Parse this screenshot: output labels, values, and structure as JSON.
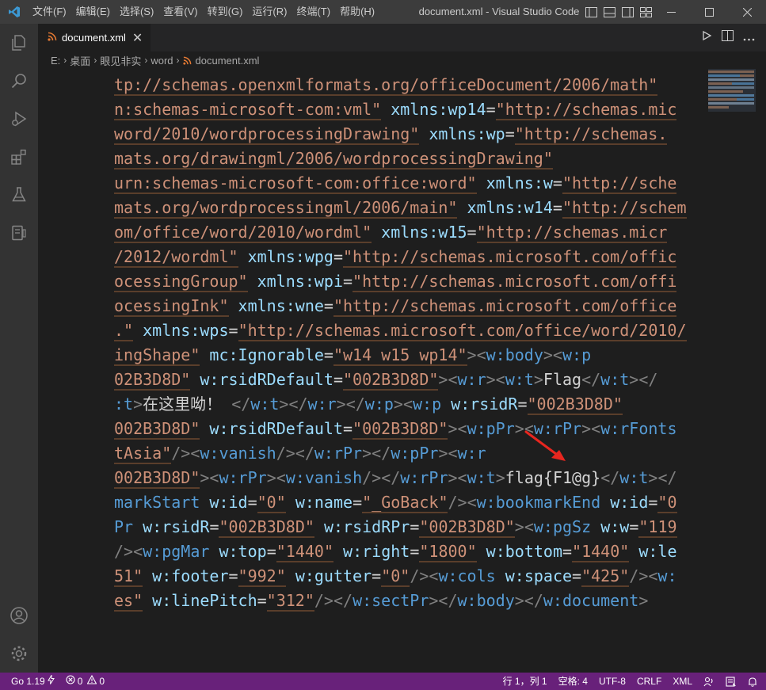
{
  "titlebar": {
    "menu": [
      "文件(F)",
      "编辑(E)",
      "选择(S)",
      "查看(V)",
      "转到(G)",
      "运行(R)",
      "终端(T)",
      "帮助(H)"
    ],
    "window_title": "document.xml - Visual Studio Code"
  },
  "tabs": [
    {
      "label": "document.xml",
      "icon": "rss-icon",
      "active": true
    }
  ],
  "breadcrumb": [
    "E:",
    "桌面",
    "眼见非实",
    "word",
    "document.xml"
  ],
  "code_lines": [
    [
      [
        "t-str",
        "tp://schemas.openxmlformats.org/officeDocument/2006/math\""
      ]
    ],
    [
      [
        "t-str",
        "n:schemas-microsoft-com:vml\""
      ],
      [
        "t-text",
        " "
      ],
      [
        "t-attr",
        "xmlns:wp14"
      ],
      [
        "t-text",
        "="
      ],
      [
        "t-str",
        "\"http://schemas.mic"
      ]
    ],
    [
      [
        "t-str",
        "word/2010/wordprocessingDrawing\""
      ],
      [
        "t-text",
        " "
      ],
      [
        "t-attr",
        "xmlns:wp"
      ],
      [
        "t-text",
        "="
      ],
      [
        "t-str",
        "\"http://schemas."
      ]
    ],
    [
      [
        "t-str",
        "mats.org/drawingml/2006/wordprocessingDrawing\""
      ]
    ],
    [
      [
        "t-str",
        "urn:schemas-microsoft-com:office:word\""
      ],
      [
        "t-text",
        " "
      ],
      [
        "t-attr",
        "xmlns:w"
      ],
      [
        "t-text",
        "="
      ],
      [
        "t-str",
        "\"http://sche"
      ]
    ],
    [
      [
        "t-str",
        "mats.org/wordprocessingml/2006/main\""
      ],
      [
        "t-text",
        " "
      ],
      [
        "t-attr",
        "xmlns:w14"
      ],
      [
        "t-text",
        "="
      ],
      [
        "t-str",
        "\"http://schem"
      ]
    ],
    [
      [
        "t-str",
        "om/office/word/2010/wordml\""
      ],
      [
        "t-text",
        " "
      ],
      [
        "t-attr",
        "xmlns:w15"
      ],
      [
        "t-text",
        "="
      ],
      [
        "t-str",
        "\"http://schemas.micr"
      ]
    ],
    [
      [
        "t-str",
        "/2012/wordml\""
      ],
      [
        "t-text",
        " "
      ],
      [
        "t-attr",
        "xmlns:wpg"
      ],
      [
        "t-text",
        "="
      ],
      [
        "t-str",
        "\"http://schemas.microsoft.com/offic"
      ]
    ],
    [
      [
        "t-str",
        "ocessingGroup\""
      ],
      [
        "t-text",
        " "
      ],
      [
        "t-attr",
        "xmlns:wpi"
      ],
      [
        "t-text",
        "="
      ],
      [
        "t-str",
        "\"http://schemas.microsoft.com/offi"
      ]
    ],
    [
      [
        "t-str",
        "ocessingInk\""
      ],
      [
        "t-text",
        " "
      ],
      [
        "t-attr",
        "xmlns:wne"
      ],
      [
        "t-text",
        "="
      ],
      [
        "t-str",
        "\"http://schemas.microsoft.com/office"
      ]
    ],
    [
      [
        "t-str",
        ".\""
      ],
      [
        "t-text",
        " "
      ],
      [
        "t-attr",
        "xmlns:wps"
      ],
      [
        "t-text",
        "="
      ],
      [
        "t-str",
        "\"http://schemas.microsoft.com/office/word/2010/"
      ]
    ],
    [
      [
        "t-str",
        "ingShape\""
      ],
      [
        "t-text",
        " "
      ],
      [
        "t-attr",
        "mc:Ignorable"
      ],
      [
        "t-text",
        "="
      ],
      [
        "t-str",
        "\"w14 w15 wp14\""
      ],
      [
        "t-punc",
        "><"
      ],
      [
        "t-tag",
        "w:body"
      ],
      [
        "t-punc",
        "><"
      ],
      [
        "t-tag",
        "w:p"
      ]
    ],
    [
      [
        "t-str",
        "02B3D8D\""
      ],
      [
        "t-text",
        " "
      ],
      [
        "t-attr",
        "w:rsidRDefault"
      ],
      [
        "t-text",
        "="
      ],
      [
        "t-str",
        "\"002B3D8D\""
      ],
      [
        "t-punc",
        "><"
      ],
      [
        "t-tag",
        "w:r"
      ],
      [
        "t-punc",
        "><"
      ],
      [
        "t-tag",
        "w:t"
      ],
      [
        "t-punc",
        ">"
      ],
      [
        "t-text",
        "Flag"
      ],
      [
        "t-punc",
        "</"
      ],
      [
        "t-tag",
        "w:t"
      ],
      [
        "t-punc",
        "></"
      ]
    ],
    [
      [
        "t-tag",
        ":t"
      ],
      [
        "t-punc",
        ">"
      ],
      [
        "t-text",
        "在这里呦！ "
      ],
      [
        "t-punc",
        "</"
      ],
      [
        "t-tag",
        "w:t"
      ],
      [
        "t-punc",
        "></"
      ],
      [
        "t-tag",
        "w:r"
      ],
      [
        "t-punc",
        "></"
      ],
      [
        "t-tag",
        "w:p"
      ],
      [
        "t-punc",
        "><"
      ],
      [
        "t-tag",
        "w:p"
      ],
      [
        "t-text",
        " "
      ],
      [
        "t-attr",
        "w:rsidR"
      ],
      [
        "t-text",
        "="
      ],
      [
        "t-str",
        "\"002B3D8D\""
      ]
    ],
    [
      [
        "t-str",
        "002B3D8D\""
      ],
      [
        "t-text",
        " "
      ],
      [
        "t-attr",
        "w:rsidRDefault"
      ],
      [
        "t-text",
        "="
      ],
      [
        "t-str",
        "\"002B3D8D\""
      ],
      [
        "t-punc",
        "><"
      ],
      [
        "t-tag",
        "w:pPr"
      ],
      [
        "t-punc",
        "><"
      ],
      [
        "t-tag",
        "w:rPr"
      ],
      [
        "t-punc",
        "><"
      ],
      [
        "t-tag",
        "w:rFonts"
      ]
    ],
    [
      [
        "t-str",
        "tAsia\""
      ],
      [
        "t-punc",
        "/><"
      ],
      [
        "t-tag",
        "w:vanish"
      ],
      [
        "t-punc",
        "/></"
      ],
      [
        "t-tag",
        "w:rPr"
      ],
      [
        "t-punc",
        "></"
      ],
      [
        "t-tag",
        "w:pPr"
      ],
      [
        "t-punc",
        "><"
      ],
      [
        "t-tag",
        "w:r"
      ]
    ],
    [
      [
        "t-str",
        "002B3D8D\""
      ],
      [
        "t-punc",
        "><"
      ],
      [
        "t-tag",
        "w:rPr"
      ],
      [
        "t-punc",
        "><"
      ],
      [
        "t-tag",
        "w:vanish"
      ],
      [
        "t-punc",
        "/></"
      ],
      [
        "t-tag",
        "w:rPr"
      ],
      [
        "t-punc",
        "><"
      ],
      [
        "t-tag",
        "w:t"
      ],
      [
        "t-punc",
        ">"
      ],
      [
        "t-text",
        "flag{F1@g}"
      ],
      [
        "t-punc",
        "</"
      ],
      [
        "t-tag",
        "w:t"
      ],
      [
        "t-punc",
        "></"
      ]
    ],
    [
      [
        "t-tag",
        "markStart"
      ],
      [
        "t-text",
        " "
      ],
      [
        "t-attr",
        "w:id"
      ],
      [
        "t-text",
        "="
      ],
      [
        "t-str",
        "\"0\""
      ],
      [
        "t-text",
        " "
      ],
      [
        "t-attr",
        "w:name"
      ],
      [
        "t-text",
        "="
      ],
      [
        "t-str",
        "\"_GoBack\""
      ],
      [
        "t-punc",
        "/><"
      ],
      [
        "t-tag",
        "w:bookmarkEnd"
      ],
      [
        "t-text",
        " "
      ],
      [
        "t-attr",
        "w:id"
      ],
      [
        "t-text",
        "="
      ],
      [
        "t-str",
        "\"0"
      ]
    ],
    [
      [
        "t-tag",
        "Pr"
      ],
      [
        "t-text",
        " "
      ],
      [
        "t-attr",
        "w:rsidR"
      ],
      [
        "t-text",
        "="
      ],
      [
        "t-str",
        "\"002B3D8D\""
      ],
      [
        "t-text",
        " "
      ],
      [
        "t-attr",
        "w:rsidRPr"
      ],
      [
        "t-text",
        "="
      ],
      [
        "t-str",
        "\"002B3D8D\""
      ],
      [
        "t-punc",
        "><"
      ],
      [
        "t-tag",
        "w:pgSz"
      ],
      [
        "t-text",
        " "
      ],
      [
        "t-attr",
        "w:w"
      ],
      [
        "t-text",
        "="
      ],
      [
        "t-str",
        "\"119"
      ]
    ],
    [
      [
        "t-punc",
        "/><"
      ],
      [
        "t-tag",
        "w:pgMar"
      ],
      [
        "t-text",
        " "
      ],
      [
        "t-attr",
        "w:top"
      ],
      [
        "t-text",
        "="
      ],
      [
        "t-str",
        "\"1440\""
      ],
      [
        "t-text",
        " "
      ],
      [
        "t-attr",
        "w:right"
      ],
      [
        "t-text",
        "="
      ],
      [
        "t-str",
        "\"1800\""
      ],
      [
        "t-text",
        " "
      ],
      [
        "t-attr",
        "w:bottom"
      ],
      [
        "t-text",
        "="
      ],
      [
        "t-str",
        "\"1440\""
      ],
      [
        "t-text",
        " "
      ],
      [
        "t-attr",
        "w:le"
      ]
    ],
    [
      [
        "t-str",
        "51\""
      ],
      [
        "t-text",
        " "
      ],
      [
        "t-attr",
        "w:footer"
      ],
      [
        "t-text",
        "="
      ],
      [
        "t-str",
        "\"992\""
      ],
      [
        "t-text",
        " "
      ],
      [
        "t-attr",
        "w:gutter"
      ],
      [
        "t-text",
        "="
      ],
      [
        "t-str",
        "\"0\""
      ],
      [
        "t-punc",
        "/><"
      ],
      [
        "t-tag",
        "w:cols"
      ],
      [
        "t-text",
        " "
      ],
      [
        "t-attr",
        "w:space"
      ],
      [
        "t-text",
        "="
      ],
      [
        "t-str",
        "\"425\""
      ],
      [
        "t-punc",
        "/><"
      ],
      [
        "t-tag",
        "w:"
      ]
    ],
    [
      [
        "t-str",
        "es\""
      ],
      [
        "t-text",
        " "
      ],
      [
        "t-attr",
        "w:linePitch"
      ],
      [
        "t-text",
        "="
      ],
      [
        "t-str",
        "\"312\""
      ],
      [
        "t-punc",
        "/></"
      ],
      [
        "t-tag",
        "w:sectPr"
      ],
      [
        "t-punc",
        "></"
      ],
      [
        "t-tag",
        "w:body"
      ],
      [
        "t-punc",
        "></"
      ],
      [
        "t-tag",
        "w:document"
      ],
      [
        "t-punc",
        ">"
      ]
    ]
  ],
  "statusbar": {
    "go_version": "Go 1.19",
    "errors": "0",
    "warnings": "0",
    "position": "行 1，列 1",
    "indent": "空格: 4",
    "encoding": "UTF-8",
    "eol": "CRLF",
    "language": "XML"
  },
  "colors": {
    "statusbar": "#68217a",
    "tag": "#569cd6",
    "attribute": "#9cdcfe",
    "string": "#ce9178",
    "text": "#d4d4d4",
    "annotation_arrow": "#e8261f"
  }
}
